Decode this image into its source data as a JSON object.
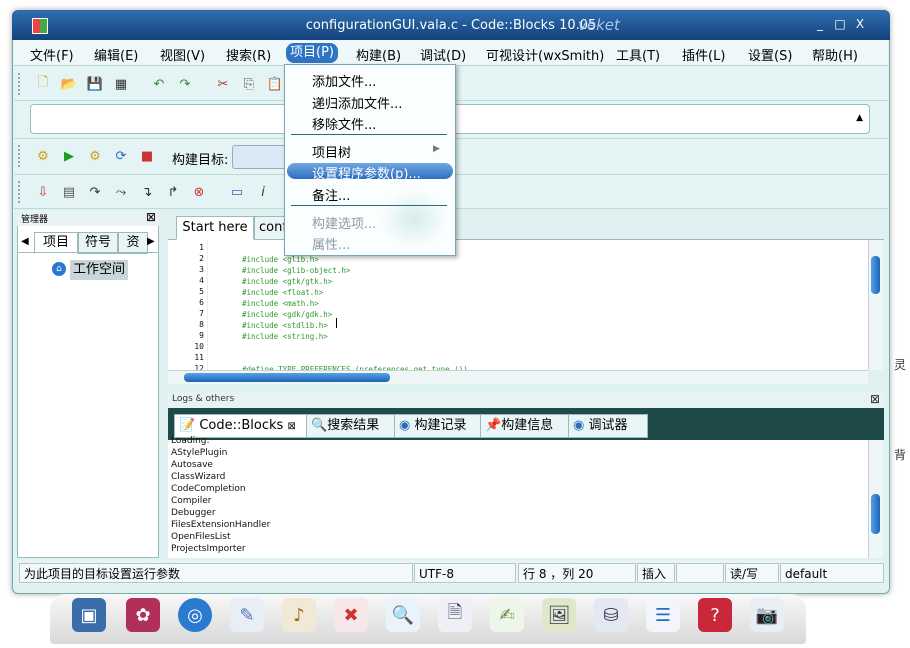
{
  "window": {
    "title": "configurationGUI.vala.c - Code::Blocks 10.05",
    "brand": "veket"
  },
  "window_controls": {
    "minimize": "_",
    "maximize": "□",
    "close": "X"
  },
  "menubar": [
    {
      "label": "文件(F)"
    },
    {
      "label": "编辑(E)"
    },
    {
      "label": "视图(V)"
    },
    {
      "label": "搜索(R)"
    },
    {
      "label": "项目(P)"
    },
    {
      "label": "构建(B)"
    },
    {
      "label": "调试(D)"
    },
    {
      "label": "可视设计(wxSmith)"
    },
    {
      "label": "工具(T)"
    },
    {
      "label": "插件(L)"
    },
    {
      "label": "设置(S)"
    },
    {
      "label": "帮助(H)"
    }
  ],
  "project_menu": {
    "items": [
      "添加文件...",
      "递归添加文件...",
      "移除文件...",
      "项目树",
      "设置程序参数(p)...",
      "备注...",
      "构建选项...",
      "属性..."
    ],
    "submenu_arrow": "▶"
  },
  "toolbar": {
    "build_target_label": "构建目标:"
  },
  "manager": {
    "title": "管理器",
    "close": "⊠",
    "tabs": [
      "项目",
      "符号",
      "资"
    ],
    "workspace": "工作空间"
  },
  "editor": {
    "tabs": [
      "Start here",
      "conf"
    ],
    "line_numbers": [
      "1",
      "2",
      "3",
      "4",
      "5",
      "6",
      "7",
      "8",
      "9",
      "10",
      "11",
      "12"
    ],
    "lines": [
      "",
      "#include <glib.h>",
      "#include <glib-object.h>",
      "#include <gtk/gtk.h>",
      "#include <float.h>",
      "#include <math.h>",
      "#include <gdk/gdk.h>",
      "#include <stdlib.h>",
      "#include <string.h>",
      "",
      "",
      "#define TYPE_PREFERENCES (preferences_get_type ())"
    ]
  },
  "logs": {
    "title": "Logs & others",
    "close": "⊠",
    "tabs": [
      "Code::Blocks",
      "搜索结果",
      "构建记录",
      "构建信息",
      "调试器"
    ],
    "lines": [
      "Loading:",
      "AStylePlugin",
      "Autosave",
      "ClassWizard",
      "CodeCompletion",
      "Compiler",
      "Debugger",
      "FilesExtensionHandler",
      "OpenFilesList",
      "ProjectsImporter"
    ]
  },
  "statusbar": {
    "message": "为此项目的目标设置运行参数",
    "encoding": "UTF-8",
    "position": "行 8 ，列 20",
    "mode": "插入",
    "access": "读/写",
    "profile": "default"
  },
  "side_peek": [
    "灵",
    "背"
  ],
  "colors": {
    "titlebar": "#1f5394",
    "menu_highlight": "#2f74c4",
    "code_text": "#2e9a2e"
  }
}
